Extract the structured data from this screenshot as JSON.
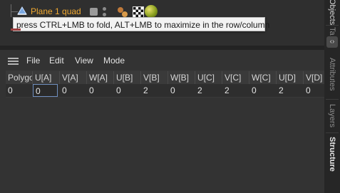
{
  "object_manager": {
    "object_name": "Plane 1 quad",
    "tooltip": "press CTRL+LMB to fold, ALT+LMB to maximize in the row/column"
  },
  "side_tabs": [
    {
      "label": "Objects",
      "active": false
    },
    {
      "label": "Ta",
      "active": false
    },
    {
      "label": "Attributes",
      "active": false
    },
    {
      "label": "Layers",
      "active": false
    },
    {
      "label": "Structure",
      "active": true
    }
  ],
  "structure": {
    "menu": [
      "File",
      "Edit",
      "View",
      "Mode"
    ],
    "columns": [
      "Polygon",
      "U[A]",
      "V[A]",
      "W[A]",
      "U[B]",
      "V[B]",
      "W[B]",
      "U[C]",
      "V[C]",
      "W[C]",
      "U[D]",
      "V[D]"
    ],
    "rows": [
      [
        "0",
        "0",
        "0",
        "0",
        "0",
        "2",
        "0",
        "2",
        "2",
        "0",
        "2",
        "0"
      ]
    ]
  },
  "colors": {
    "object_name": "#f0a830",
    "tooltip_bg": "#f2f2f2",
    "selection_border": "#6f8fbf"
  }
}
